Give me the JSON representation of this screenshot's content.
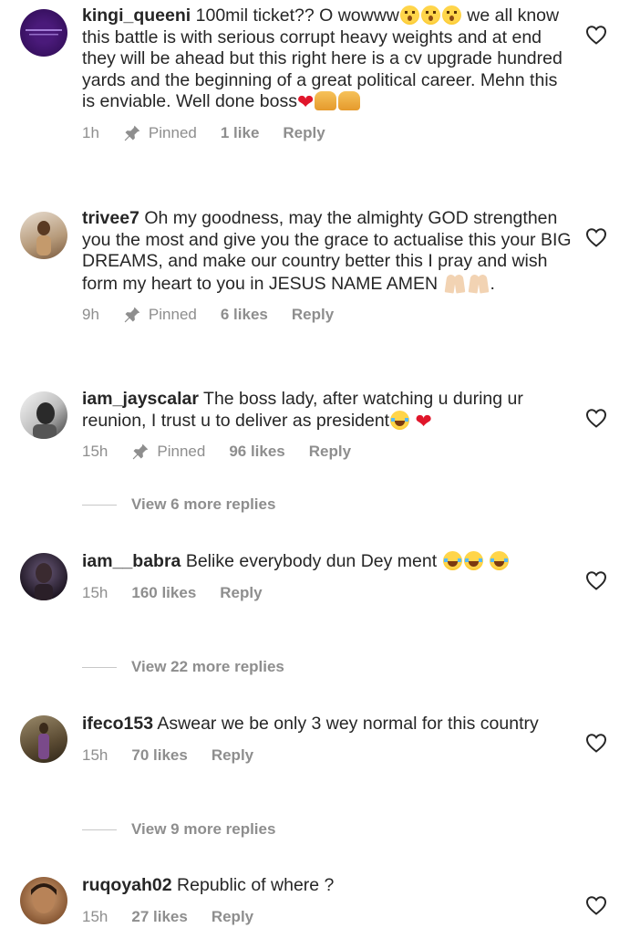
{
  "comments": [
    {
      "username": "kingi_queeni",
      "text_parts": [
        "100mil ticket?? O wowww",
        " we all know this battle is with serious corrupt heavy weights and at end they will be ahead but this right here is a cv upgrade hundred yards and the beginning of a great political career. Mehn this is enviable. Well done boss"
      ],
      "time": "1h",
      "pinned": "Pinned",
      "likes": "1 like",
      "reply": "Reply"
    },
    {
      "username": "trivee7",
      "text_parts": [
        "Oh my goodness, may the almighty GOD strengthen you the most and give you the grace to actualise this your BIG DREAMS, and make our country better this I pray and wish form my heart to you in JESUS NAME AMEN ",
        "."
      ],
      "time": "9h",
      "pinned": "Pinned",
      "likes": "6 likes",
      "reply": "Reply"
    },
    {
      "username": "iam_jayscalar",
      "text_parts": [
        "The boss lady, after watching u during ur reunion, I trust u to deliver as president"
      ],
      "time": "15h",
      "pinned": "Pinned",
      "likes": "96 likes",
      "reply": "Reply",
      "view_more": "View 6 more replies"
    },
    {
      "username": "iam__babra",
      "text_parts": [
        "Belike everybody dun Dey ment "
      ],
      "time": "15h",
      "likes": "160 likes",
      "reply": "Reply",
      "view_more": "View 22 more replies"
    },
    {
      "username": "ifeco153",
      "text_parts": [
        "Aswear we be only 3 wey normal for this country"
      ],
      "time": "15h",
      "likes": "70 likes",
      "reply": "Reply",
      "view_more": "View 9 more replies"
    },
    {
      "username": "ruqoyah02",
      "text_parts": [
        "Republic of where ?"
      ],
      "time": "15h",
      "likes": "27 likes",
      "reply": "Reply"
    }
  ],
  "icons": {
    "like": "heart-outline-icon",
    "pin": "pin-icon"
  },
  "colors": {
    "text": "#262626",
    "muted": "#8e8e8e"
  }
}
